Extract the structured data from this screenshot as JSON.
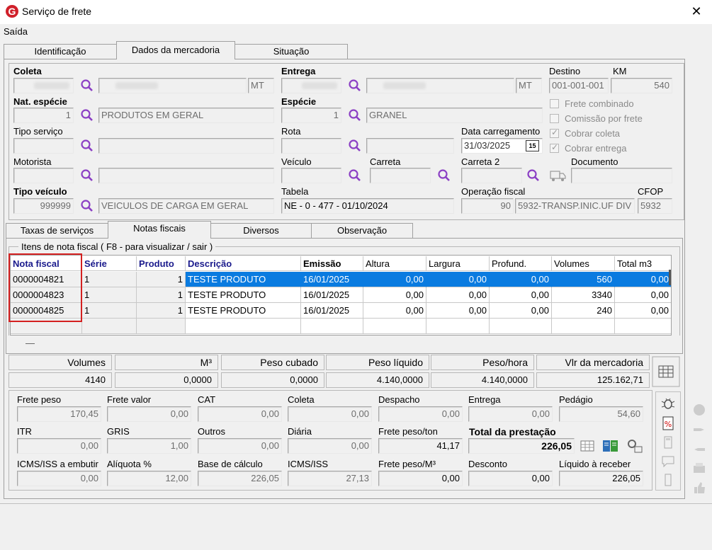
{
  "window": {
    "title": "Serviço de frete",
    "close": "✕"
  },
  "menu": {
    "saida": "Saída"
  },
  "main_tabs": [
    {
      "label": "Identificação"
    },
    {
      "label": "Dados da mercadoria"
    },
    {
      "label": "Situação"
    }
  ],
  "form": {
    "coleta": {
      "label": "Coleta",
      "uf": "MT"
    },
    "entrega": {
      "label": "Entrega",
      "uf": "MT"
    },
    "destino": {
      "label": "Destino",
      "value": "001-001-001"
    },
    "km": {
      "label": "KM",
      "value": "540"
    },
    "nat_especie": {
      "label": "Nat. espécie",
      "code": "1",
      "desc": "PRODUTOS EM GERAL"
    },
    "especie": {
      "label": "Espécie",
      "code": "1",
      "desc": "GRANEL"
    },
    "tipo_servico": {
      "label": "Tipo serviço"
    },
    "rota": {
      "label": "Rota"
    },
    "data_carregamento": {
      "label": "Data carregamento",
      "value": "31/03/2025",
      "cal_icon": "15"
    },
    "motorista": {
      "label": "Motorista"
    },
    "veiculo": {
      "label": "Veículo"
    },
    "carreta": {
      "label": "Carreta"
    },
    "carreta2": {
      "label": "Carreta 2"
    },
    "documento": {
      "label": "Documento"
    },
    "tipo_veiculo": {
      "label": "Tipo veículo",
      "code": "999999",
      "desc": "VEICULOS DE CARGA EM GERAL"
    },
    "tabela": {
      "label": "Tabela",
      "value": "NE - 0 - 477 - 01/10/2024"
    },
    "operacao_fiscal": {
      "label": "Operação fiscal",
      "code": "90",
      "desc": "5932-TRANSP.INIC.UF DIV"
    },
    "cfop": {
      "label": "CFOP",
      "value": "5932"
    },
    "checks": [
      {
        "label": "Frete combinado",
        "checked": false
      },
      {
        "label": "Comissão por frete",
        "checked": false
      },
      {
        "label": "Cobrar coleta",
        "checked": true
      },
      {
        "label": "Cobrar entrega",
        "checked": true
      }
    ]
  },
  "sub_tabs": [
    {
      "label": "Taxas de serviços"
    },
    {
      "label": "Notas fiscais"
    },
    {
      "label": "Diversos"
    },
    {
      "label": "Observação"
    }
  ],
  "notas": {
    "group_label": "Itens de nota fiscal ( F8 - para visualizar / sair )",
    "headers": [
      "Nota fiscal",
      "Série",
      "Produto",
      "Descrição",
      "Emissão",
      "Altura",
      "Largura",
      "Profund.",
      "Volumes",
      "Total m3"
    ],
    "rows": [
      [
        "0000004821",
        "1",
        "1",
        "TESTE PRODUTO",
        "16/01/2025",
        "0,00",
        "0,00",
        "0,00",
        "560",
        "0,00"
      ],
      [
        "0000004823",
        "1",
        "1",
        "TESTE PRODUTO",
        "16/01/2025",
        "0,00",
        "0,00",
        "0,00",
        "3340",
        "0,00"
      ],
      [
        "0000004825",
        "1",
        "1",
        "TESTE PRODUTO",
        "16/01/2025",
        "0,00",
        "0,00",
        "0,00",
        "240",
        "0,00"
      ]
    ],
    "dash": "—"
  },
  "summary": {
    "headers": [
      "Volumes",
      "M³",
      "Peso cubado",
      "Peso líquido",
      "Peso/hora",
      "Vlr da mercadoria"
    ],
    "values": [
      "4140",
      "0,0000",
      "0,0000",
      "4.140,0000",
      "4.140,0000",
      "125.162,71"
    ]
  },
  "totals": {
    "row1": [
      [
        "Frete peso",
        "170,45"
      ],
      [
        "Frete valor",
        "0,00"
      ],
      [
        "CAT",
        "0,00"
      ],
      [
        "Coleta",
        "0,00"
      ],
      [
        "Despacho",
        "0,00"
      ],
      [
        "Entrega",
        "0,00"
      ],
      [
        "Pedágio",
        "54,60"
      ]
    ],
    "row2": [
      [
        "ITR",
        "0,00"
      ],
      [
        "GRIS",
        "1,00"
      ],
      [
        "Outros",
        "0,00"
      ],
      [
        "Diária",
        "0,00"
      ],
      [
        "Frete peso/ton",
        "41,17"
      ]
    ],
    "total_prestacao": {
      "label": "Total da prestação",
      "value": "226,05"
    },
    "row3": [
      [
        "ICMS/ISS a embutir",
        "0,00"
      ],
      [
        "Alíquota %",
        "12,00"
      ],
      [
        "Base de cálculo",
        "226,05"
      ],
      [
        "ICMS/ISS",
        "27,13"
      ],
      [
        "Frete peso/M³",
        "0,00"
      ],
      [
        "Desconto",
        "0,00"
      ],
      [
        "Líquido à receber",
        "226,05"
      ]
    ]
  },
  "colors": {
    "accent": "#0a7be0",
    "highlight_box": "#d42020",
    "search_icon": "#8b3fc4",
    "header_text": "#1a1a8c"
  }
}
